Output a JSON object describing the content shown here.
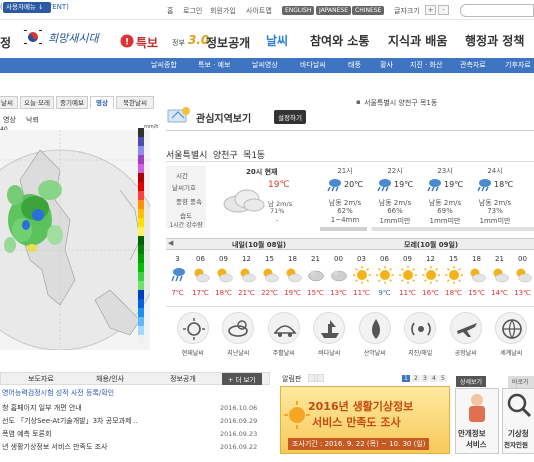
{
  "topbar": {
    "skip": "(SKIP TO CONTENT)",
    "links": [
      "홈",
      "로그인",
      "회원가입",
      "사이트맵"
    ],
    "langs": [
      "ENGLISH",
      "JAPANESE",
      "CHINESE"
    ],
    "font_size_label": "글자크기",
    "plus": "+",
    "minus": "-"
  },
  "gnb": {
    "left_cut": "정",
    "slogan": "희망새시대",
    "item1": "특보",
    "item2_prefix": "정부",
    "item2_num": "3.0",
    "item2_suffix": "정보공개",
    "menu": [
      "날씨",
      "참여와 소통",
      "지식과 배움",
      "행정과 정책"
    ]
  },
  "subnav": {
    "select": "사용자메뉴 ↓",
    "items": [
      "날씨종합",
      "특보 · 예보",
      "날씨영상",
      "바다날씨",
      "태풍",
      "황사",
      "지진 · 화산",
      "관측자료",
      "기후자료"
    ]
  },
  "left": {
    "tabs": [
      "날씨",
      "오늘·모레",
      "중기예보",
      "영상",
      "북한날씨"
    ],
    "subtabs": [
      "영상",
      "낙뢰"
    ],
    "time_cut": "40",
    "unit": "mm/h",
    "scale": [
      "150",
      "110",
      "90",
      "70",
      "60",
      "50",
      "40",
      "30",
      "25",
      "20",
      "15",
      "10",
      "9",
      "8",
      "7",
      "6",
      "5",
      "4",
      "3",
      "2",
      "1",
      "0.5",
      "0.1",
      "0"
    ]
  },
  "interest": {
    "title": "관심지역보기",
    "settings": "설정하기",
    "location_top": "서울특별시 양천구 목1동",
    "location_main": "서울특별시 양천구 목1동"
  },
  "current": {
    "labels": [
      "시간",
      "날씨기호",
      "풍향 풍속",
      "습도",
      "1시간 강수량"
    ],
    "time": "20시 현재",
    "temp": "19℃",
    "wind": "남 2m/s",
    "humidity": "71%",
    "rain": "-"
  },
  "hours": [
    {
      "hour": "21시",
      "temp": "20℃",
      "wind": "남동 2m/s",
      "hum": "62%",
      "rain": "1~4mm"
    },
    {
      "hour": "22시",
      "temp": "19℃",
      "wind": "남동 2m/s",
      "hum": "66%",
      "rain": "1mm미만"
    },
    {
      "hour": "23시",
      "temp": "19℃",
      "wind": "남동 2m/s",
      "hum": "69%",
      "rain": "1mm미만"
    },
    {
      "hour": "24시",
      "temp": "18℃",
      "wind": "남동 2m/s",
      "hum": "73%",
      "rain": "1mm미만"
    }
  ],
  "timeline": {
    "prev": "◀",
    "day1": "내일(10월 08일)",
    "day2": "모레(10월 09일)",
    "hours": [
      "3",
      "06",
      "09",
      "12",
      "15",
      "18",
      "21",
      "00",
      "03",
      "06",
      "09",
      "12",
      "15",
      "18",
      "21",
      "00"
    ],
    "temps": [
      "7℃",
      "17℃",
      "18℃",
      "21℃",
      "22℃",
      "19℃",
      "15℃",
      "13℃",
      "11℃",
      "9℃",
      "11℃",
      "16℃",
      "18℃",
      "15℃",
      "14℃",
      "13℃"
    ],
    "temp_colors": [
      "#e03030",
      "#e03030",
      "#e03030",
      "#e03030",
      "#e03030",
      "#e03030",
      "#e03030",
      "#e03030",
      "#e03030",
      "#3060d0",
      "#e03030",
      "#e03030",
      "#e03030",
      "#e03030",
      "#e03030",
      "#e03030"
    ],
    "icons": [
      "shower",
      "sun-cloud",
      "sun-cloud",
      "sun-cloud",
      "sun-cloud",
      "sun-cloud",
      "cloud-grey",
      "cloud-grey",
      "sun",
      "sun",
      "sun",
      "sun",
      "sun",
      "sun-cloud",
      "sun-cloud",
      "sun-cloud"
    ]
  },
  "categories": [
    "현재날씨",
    "지난날씨",
    "주활날씨",
    "바다날씨",
    "산악날씨",
    "지진/해일",
    "공항날씨",
    "세계날씨"
  ],
  "news": {
    "tabs": [
      "보도자료",
      "채용/인사",
      "정보공개"
    ],
    "more": "+ 더 보기",
    "items": [
      {
        "text": "영어능력검정시험 성적 사전 등록/확인",
        "date": ""
      },
      {
        "text": "청 홈페이지 일부 개편 안내",
        "date": "2016.10.06"
      },
      {
        "text": "선도 「기상See-At기술개발」3차 공모과제 ..",
        "date": "2016.09.29"
      },
      {
        "text": "폭염 예측 토론회",
        "date": "2016.09.23"
      },
      {
        "text": "년 생활기상정보 서비스 만족도 조사",
        "date": "2016.09.22"
      }
    ]
  },
  "notice": {
    "label": "알림판",
    "pages": [
      "1",
      "2",
      "3",
      "4",
      "5"
    ],
    "banner_line1": "2016년 생활기상정보",
    "banner_line2": "서비스 만족도 조사",
    "banner_period": "조사기간 : 2016. 9. 22 (목) ~ 10. 30 (일)",
    "tab_quick": "상세보기",
    "tab_quick2": "바로가기",
    "svc1_line1": "안개정보",
    "svc1_line2": "서비스",
    "svc2_line1": "기상청",
    "svc2_line2": "전자민원"
  },
  "colors": {
    "accent": "#3f74c2",
    "gnb_active": "#2a7fd4",
    "temp_red": "#e03030",
    "temp_blue": "#3060d0"
  }
}
